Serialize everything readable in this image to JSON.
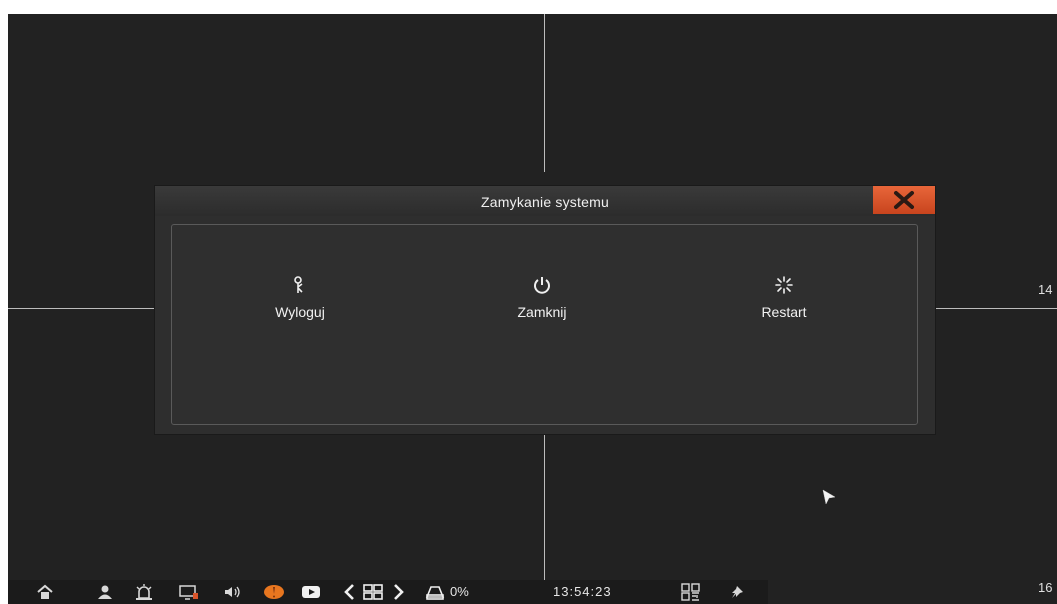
{
  "dialog": {
    "title": "Zamykanie systemu",
    "options": [
      {
        "label": "Wyloguj",
        "icon": "logout-key-icon"
      },
      {
        "label": "Zamknij",
        "icon": "power-icon"
      },
      {
        "label": "Restart",
        "icon": "restart-icon"
      }
    ],
    "close_icon": "close-icon"
  },
  "channels": {
    "right_mid": "14",
    "right_bottom": "16"
  },
  "taskbar": {
    "icons": [
      "home-icon",
      "user-icon",
      "alarm-icon",
      "monitor-icon",
      "speaker-icon",
      "record-icon",
      "playback-icon",
      "prev-icon",
      "grid-layout-icon",
      "next-icon",
      "disk-icon",
      "qr-code-icon",
      "pin-icon"
    ],
    "disk_usage": "0%",
    "time": "13:54:23"
  },
  "colors": {
    "accent": "#d9552b",
    "record": "#e8761f",
    "background": "#222222"
  }
}
